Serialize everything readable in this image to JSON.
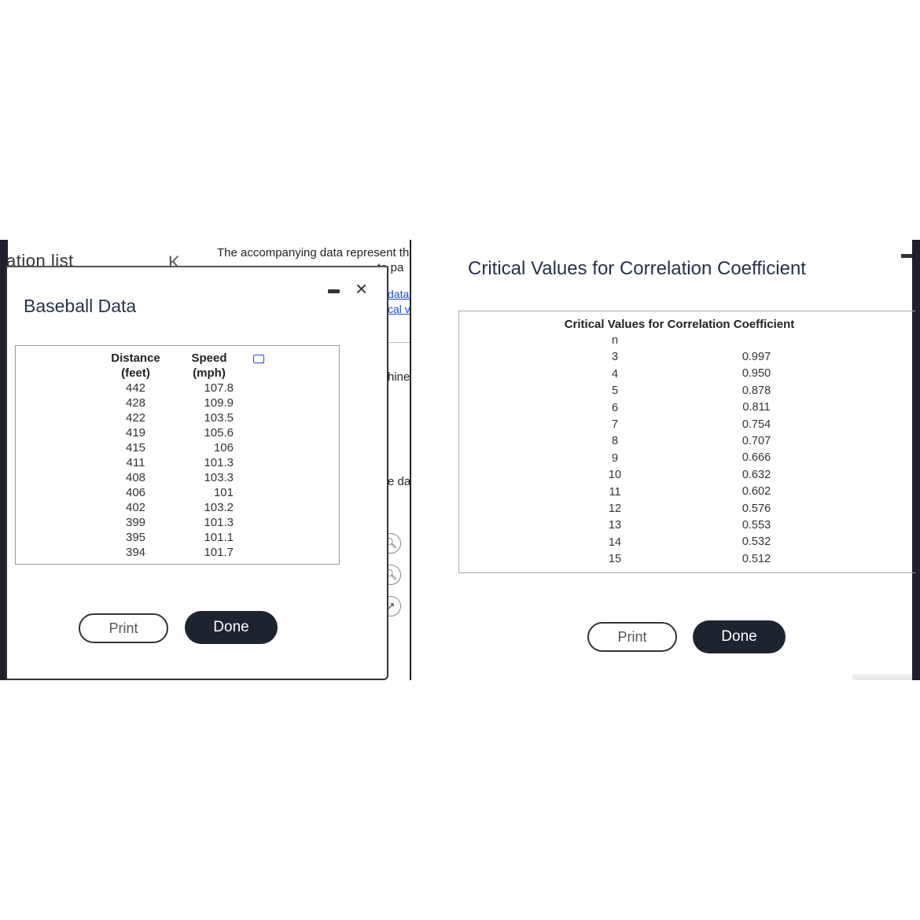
{
  "left_screenshot": {
    "background": {
      "nav_partial_text": "ation list",
      "collapse_glyph": "K",
      "description_line1": "The accompanying data represent th",
      "description_line2": "te pa",
      "link_fragment1": "data.",
      "link_fragment2": "cal v",
      "text_fragment1": "hine",
      "text_fragment2": "e da",
      "icons": [
        "zoom-in-icon",
        "zoom-out-icon",
        "expand-icon"
      ]
    },
    "dialog": {
      "title": "Baseball Data",
      "minimize_icon": "minimize-icon",
      "close_glyph": "×",
      "copy_icon": "copy-icon",
      "table": {
        "headers": [
          [
            "Distance",
            "(feet)"
          ],
          [
            "Speed",
            "(mph)"
          ]
        ],
        "rows": [
          [
            "442",
            "107.8"
          ],
          [
            "428",
            "109.9"
          ],
          [
            "422",
            "103.5"
          ],
          [
            "419",
            "105.6"
          ],
          [
            "415",
            "106"
          ],
          [
            "411",
            "101.3"
          ],
          [
            "408",
            "103.3"
          ],
          [
            "406",
            "101"
          ],
          [
            "402",
            "103.2"
          ],
          [
            "399",
            "101.3"
          ],
          [
            "395",
            "101.1"
          ],
          [
            "394",
            "101.7"
          ]
        ]
      },
      "print_label": "Print",
      "done_label": "Done"
    }
  },
  "right_screenshot": {
    "title": "Critical Values for Correlation Coefficient",
    "table": {
      "caption": "Critical Values for Correlation Coefficient",
      "n_header": "n",
      "rows": [
        [
          "3",
          "0.997"
        ],
        [
          "4",
          "0.950"
        ],
        [
          "5",
          "0.878"
        ],
        [
          "6",
          "0.811"
        ],
        [
          "7",
          "0.754"
        ],
        [
          "8",
          "0.707"
        ],
        [
          "9",
          "0.666"
        ],
        [
          "10",
          "0.632"
        ],
        [
          "11",
          "0.602"
        ],
        [
          "12",
          "0.576"
        ],
        [
          "13",
          "0.553"
        ],
        [
          "14",
          "0.532"
        ],
        [
          "15",
          "0.512"
        ]
      ]
    },
    "print_label": "Print",
    "done_label": "Done"
  },
  "colors": {
    "dark_frame": "#1f1f2e",
    "title_text": "#26324a",
    "done_button": "#1e2330",
    "link": "#1a4fd8"
  }
}
